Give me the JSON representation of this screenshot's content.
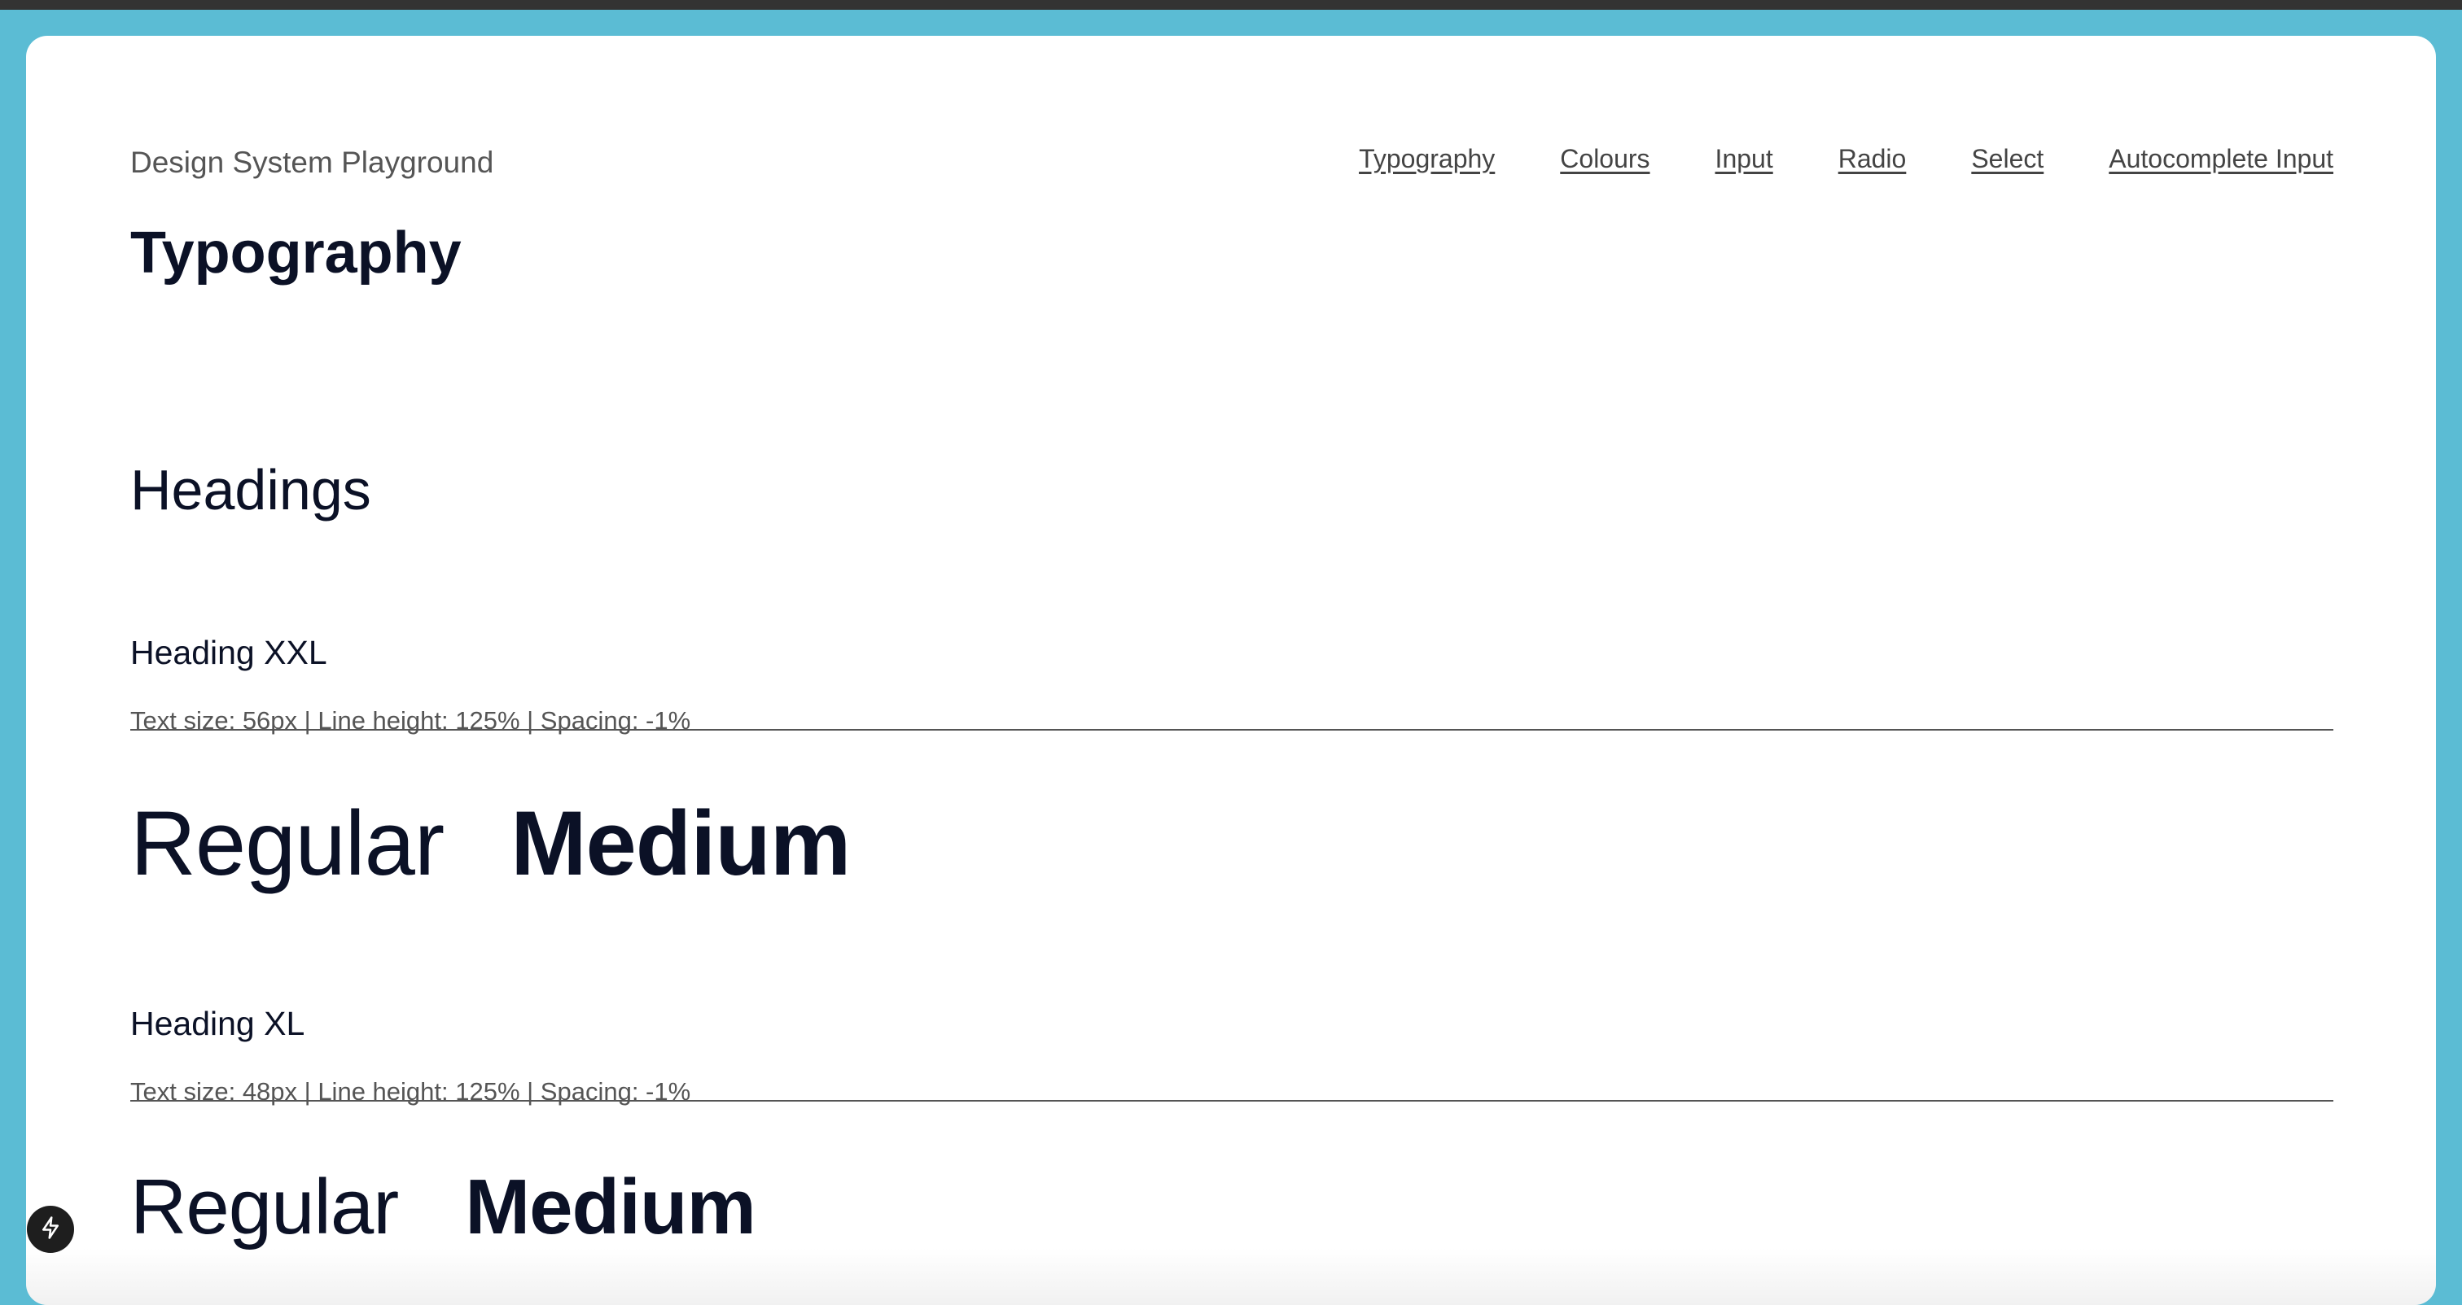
{
  "header": {
    "site_title": "Design System Playground",
    "nav": [
      {
        "label": "Typography"
      },
      {
        "label": "Colours"
      },
      {
        "label": "Input"
      },
      {
        "label": "Radio"
      },
      {
        "label": "Select"
      },
      {
        "label": "Autocomplete Input"
      }
    ]
  },
  "page": {
    "title": "Typography",
    "section_title": "Headings",
    "headings": [
      {
        "name": "Heading XXL",
        "spec": "Text size: 56px | Line height: 125% | Spacing: -1%",
        "regular_label": "Regular",
        "medium_label": "Medium"
      },
      {
        "name": "Heading XL",
        "spec": "Text size: 48px | Line height: 125% | Spacing: -1%",
        "regular_label": "Regular",
        "medium_label": "Medium"
      }
    ]
  },
  "dev_badge": {
    "icon": "lightning-icon"
  },
  "colors": {
    "frame_background": "#5bbcd4",
    "top_bar": "#333333",
    "card_background": "#ffffff",
    "heading_text": "#0b1126",
    "muted_text": "#555555",
    "badge_background": "#1e1e1e"
  }
}
